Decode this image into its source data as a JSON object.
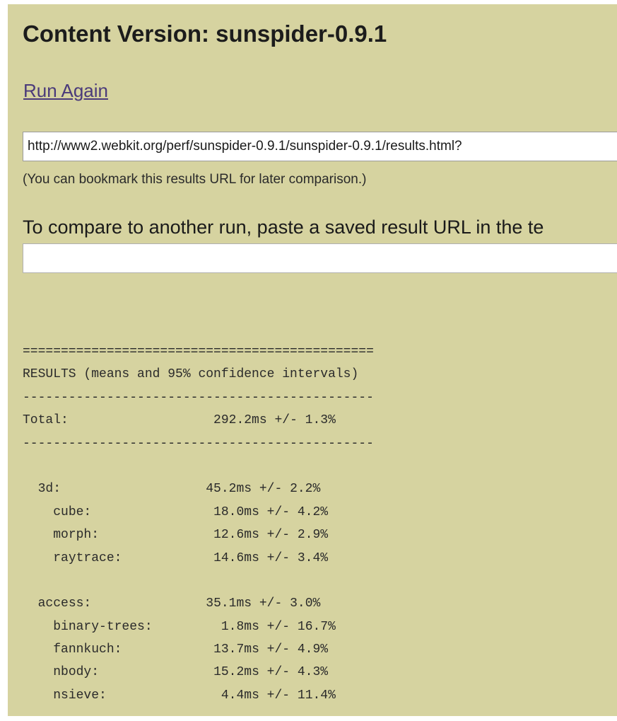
{
  "header": {
    "title": "Content Version: sunspider-0.9.1"
  },
  "links": {
    "run_again": "Run Again"
  },
  "results_url": {
    "value": "http://www2.webkit.org/perf/sunspider-0.9.1/sunspider-0.9.1/results.html?"
  },
  "bookmark_hint": "(You can bookmark this results URL for later comparison.)",
  "compare": {
    "instruction": "To compare to another run, paste a saved result URL in the te",
    "value": ""
  },
  "results": {
    "separator_double": "==============================================",
    "heading": "RESULTS (means and 95% confidence intervals)",
    "separator_single": "----------------------------------------------",
    "total": {
      "label": "Total:",
      "value": "292.2ms +/- 1.3%"
    },
    "groups": [
      {
        "name": "3d:",
        "value": "45.2ms +/- 2.2%",
        "tests": [
          {
            "name": "cube:",
            "value": "18.0ms +/- 4.2%"
          },
          {
            "name": "morph:",
            "value": "12.6ms +/- 2.9%"
          },
          {
            "name": "raytrace:",
            "value": "14.6ms +/- 3.4%"
          }
        ]
      },
      {
        "name": "access:",
        "value": "35.1ms +/- 3.0%",
        "tests": [
          {
            "name": "binary-trees:",
            "value": "1.8ms +/- 16.7%"
          },
          {
            "name": "fannkuch:",
            "value": "13.7ms +/- 4.9%"
          },
          {
            "name": "nbody:",
            "value": "15.2ms +/- 4.3%"
          },
          {
            "name": "nsieve:",
            "value": "4.4ms +/- 11.4%"
          }
        ]
      }
    ]
  }
}
